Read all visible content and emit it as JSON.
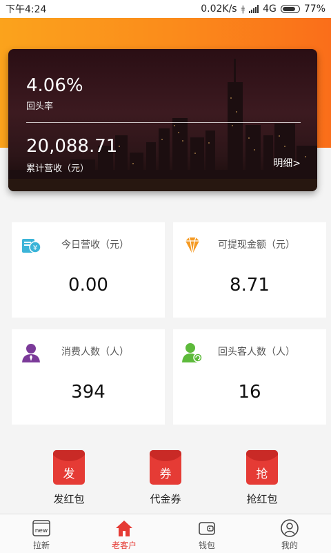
{
  "status": {
    "time": "下午4:24",
    "speed": "0.02K/s",
    "network": "4G",
    "battery": "77%"
  },
  "hero": {
    "rate_value": "4.06%",
    "rate_label": "回头率",
    "total_value": "20,088.71",
    "total_label": "累计营收（元）",
    "detail_link": "明细>"
  },
  "cards": [
    {
      "label": "今日营收（元）",
      "value": "0.00",
      "icon": "cash-register-icon",
      "color": "#3bb4d8"
    },
    {
      "label": "可提现金额（元）",
      "value": "8.71",
      "icon": "diamond-icon",
      "color": "#f59a23"
    },
    {
      "label": "消费人数（人）",
      "value": "394",
      "icon": "person-icon",
      "color": "#7b3a99"
    },
    {
      "label": "回头客人数（人）",
      "value": "16",
      "icon": "returning-customer-icon",
      "color": "#5dba3b"
    }
  ],
  "actions": [
    {
      "char": "发",
      "label": "发红包"
    },
    {
      "char": "券",
      "label": "代金券"
    },
    {
      "char": "抢",
      "label": "抢红包"
    }
  ],
  "nav": [
    {
      "label": "拉新",
      "icon": "new-icon",
      "badge": "new",
      "active": false
    },
    {
      "label": "老客户",
      "icon": "home-icon",
      "active": true
    },
    {
      "label": "钱包",
      "icon": "wallet-icon",
      "active": false
    },
    {
      "label": "我的",
      "icon": "user-icon",
      "active": false
    }
  ],
  "colors": {
    "brand_orange": "#fb8a1b",
    "accent_red": "#e53b35"
  }
}
